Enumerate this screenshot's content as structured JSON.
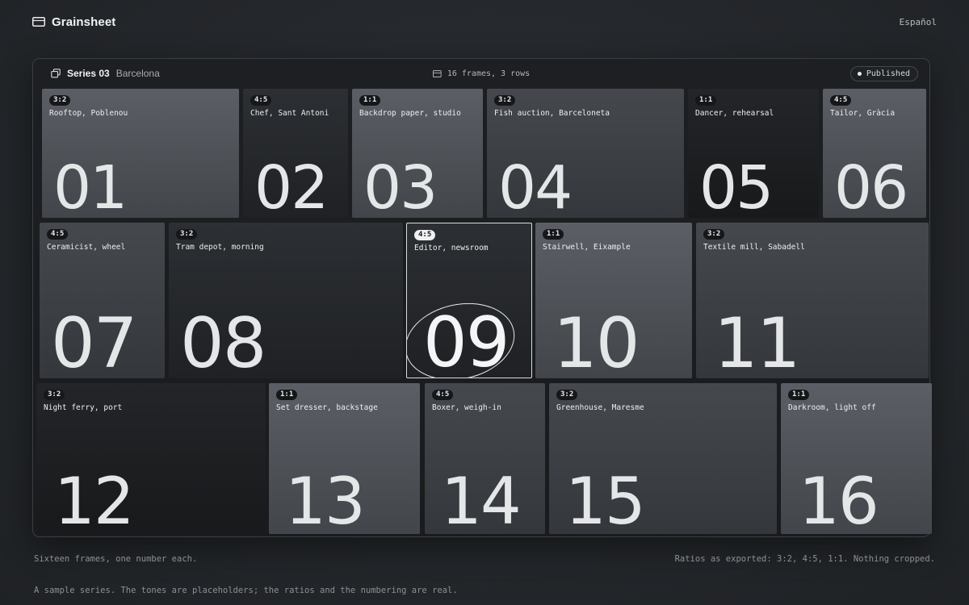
{
  "app": {
    "name": "Grainsheet",
    "language": "Español"
  },
  "sheet": {
    "series_label": "Series 03",
    "city": "Barcelona",
    "meta": "16 frames, 3 rows",
    "status": "Published"
  },
  "frames": [
    {
      "ratio": "3:2",
      "caption": "Rooftop, Poblenou",
      "number": "01"
    },
    {
      "ratio": "4:5",
      "caption": "Chef, Sant Antoni",
      "number": "02"
    },
    {
      "ratio": "1:1",
      "caption": "Backdrop paper, studio",
      "number": "03"
    },
    {
      "ratio": "3:2",
      "caption": "Fish auction, Barceloneta",
      "number": "04"
    },
    {
      "ratio": "1:1",
      "caption": "Dancer, rehearsal",
      "number": "05"
    },
    {
      "ratio": "4:5",
      "caption": "Tailor, Gràcia",
      "number": "06"
    },
    {
      "ratio": "4:5",
      "caption": "Ceramicist, wheel",
      "number": "07"
    },
    {
      "ratio": "3:2",
      "caption": "Tram depot, morning",
      "number": "08"
    },
    {
      "ratio": "4:5",
      "caption": "Editor, newsroom",
      "number": "09",
      "selected": true
    },
    {
      "ratio": "1:1",
      "caption": "Stairwell, Eixample",
      "number": "10"
    },
    {
      "ratio": "3:2",
      "caption": "Textile mill, Sabadell",
      "number": "11"
    },
    {
      "ratio": "3:2",
      "caption": "Night ferry, port",
      "number": "12"
    },
    {
      "ratio": "1:1",
      "caption": "Set dresser, backstage",
      "number": "13"
    },
    {
      "ratio": "4:5",
      "caption": "Boxer, weigh-in",
      "number": "14"
    },
    {
      "ratio": "3:2",
      "caption": "Greenhouse, Maresme",
      "number": "15"
    },
    {
      "ratio": "1:1",
      "caption": "Darkroom, light off",
      "number": "16"
    }
  ],
  "footer": {
    "left": "Sixteen frames, one number each.",
    "right": "Ratios as exported: 3:2, 4:5, 1:1. Nothing cropped.",
    "note": "A sample series. The tones are placeholders; the ratios and the numbering are real."
  },
  "colors": {
    "background": "#24272b",
    "sheet": "#1b1d20",
    "accent": "#e9ebed"
  },
  "icons": {
    "brand": "frame-icon",
    "series": "stack-icon",
    "meta": "frame-icon",
    "status": "dot-icon"
  }
}
